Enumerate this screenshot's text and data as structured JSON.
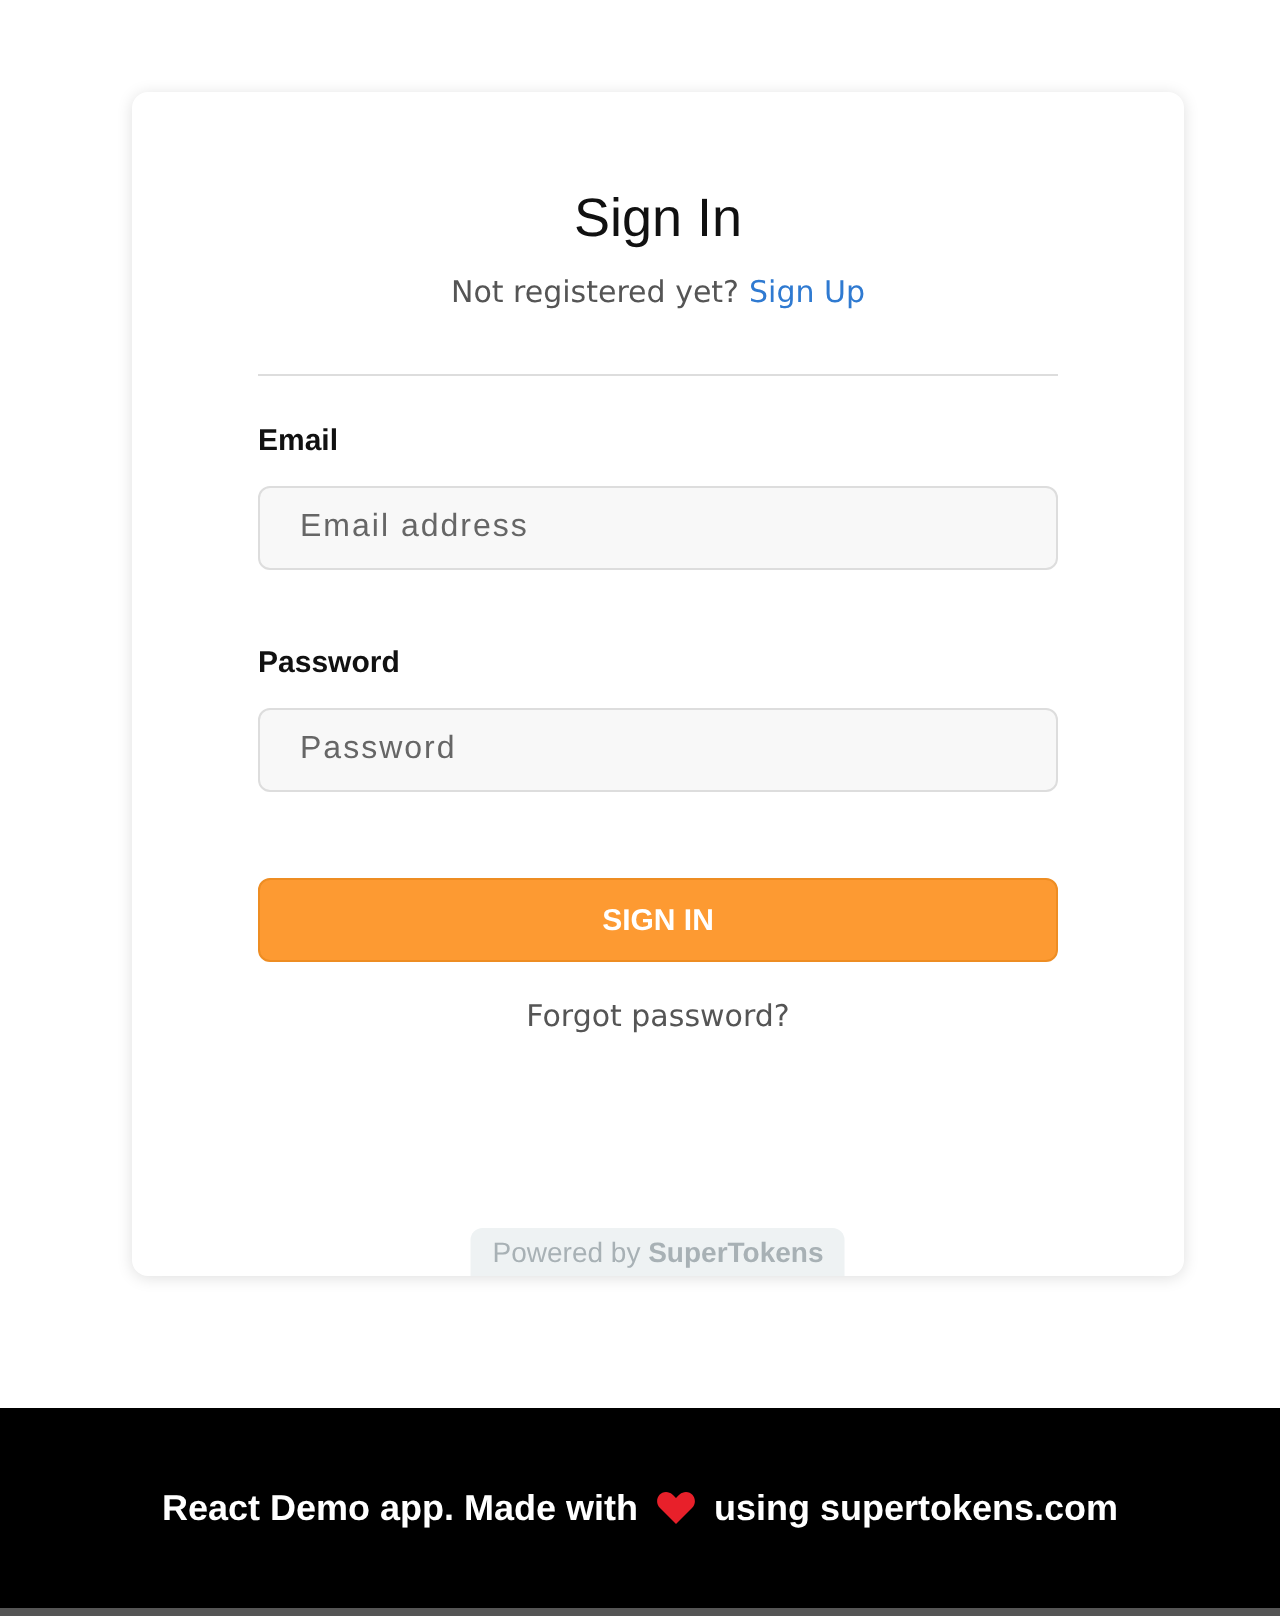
{
  "card": {
    "title": "Sign In",
    "subtitle": {
      "text": "Not registered yet?",
      "link": "Sign Up"
    },
    "fields": [
      {
        "label": "Email",
        "placeholder": "Email address"
      },
      {
        "label": "Password",
        "placeholder": "Password"
      }
    ],
    "submit": "SIGN IN",
    "forgot": "Forgot password?",
    "powered_by": "Powered by **SuperTokens**"
  },
  "footer": {
    "before": "React Demo app. Made with",
    "after": "using supertokens.com"
  }
}
